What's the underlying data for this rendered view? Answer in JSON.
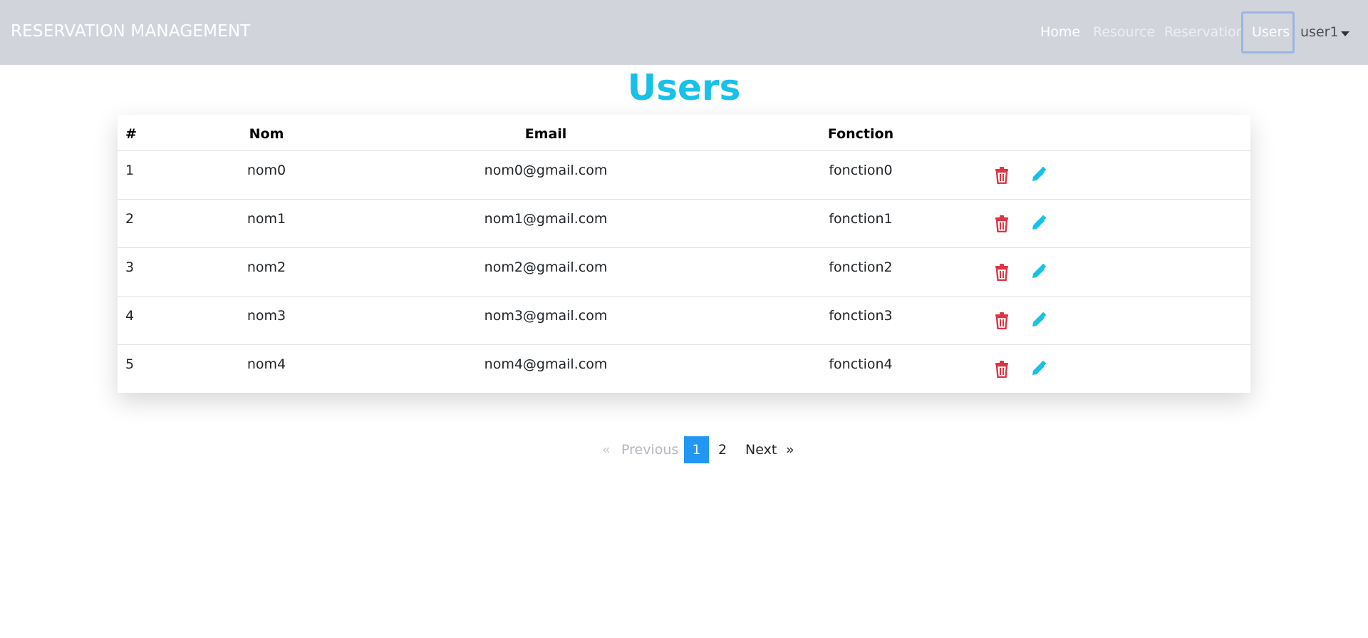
{
  "navbar": {
    "brand": "RESERVATION MANAGEMENT",
    "links": [
      "Home",
      "Resource",
      "Reservation",
      "Users"
    ],
    "user": "user1"
  },
  "page": {
    "title": "Users"
  },
  "table": {
    "headers": [
      "#",
      "Nom",
      "Email",
      "Fonction"
    ],
    "rows": [
      {
        "id": "1",
        "nom": "nom0",
        "email": "nom0@gmail.com",
        "fonction": "fonction0"
      },
      {
        "id": "2",
        "nom": "nom1",
        "email": "nom1@gmail.com",
        "fonction": "fonction1"
      },
      {
        "id": "3",
        "nom": "nom2",
        "email": "nom2@gmail.com",
        "fonction": "fonction2"
      },
      {
        "id": "4",
        "nom": "nom3",
        "email": "nom3@gmail.com",
        "fonction": "fonction3"
      },
      {
        "id": "5",
        "nom": "nom4",
        "email": "nom4@gmail.com",
        "fonction": "fonction4"
      }
    ],
    "row_actions": [
      "trash-icon",
      "pencil-icon"
    ]
  },
  "pagination": {
    "prev_arrow": "«",
    "prev": "Previous",
    "pages": [
      "1",
      "2"
    ],
    "current": "1",
    "next": "Next",
    "next_arrow": "»"
  },
  "colors": {
    "navbar_bg": "#d1d5db",
    "title": "#17c1e8",
    "delete": "#dc3545",
    "edit": "#17c1e8",
    "active_page": "#2196f3"
  }
}
